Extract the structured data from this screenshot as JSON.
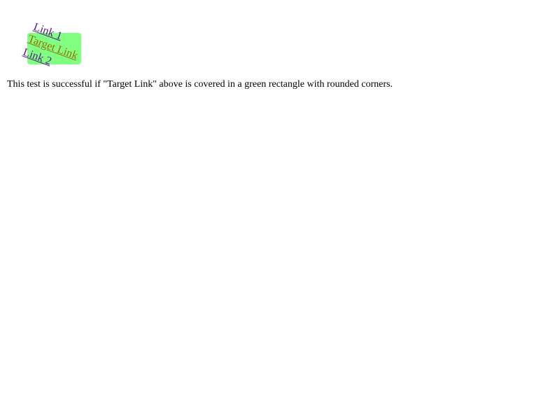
{
  "links": {
    "link1_label": "Link 1",
    "target_label": "Target Link",
    "link2_label": "Link 2"
  },
  "colors": {
    "highlight": "#80ff80",
    "visited_link": "#551a8b",
    "target_link": "#9a7000",
    "text": "#000000",
    "background": "#ffffff"
  },
  "message": "This test is successful if \"Target Link\" above is covered in a green rectangle with rounded corners."
}
